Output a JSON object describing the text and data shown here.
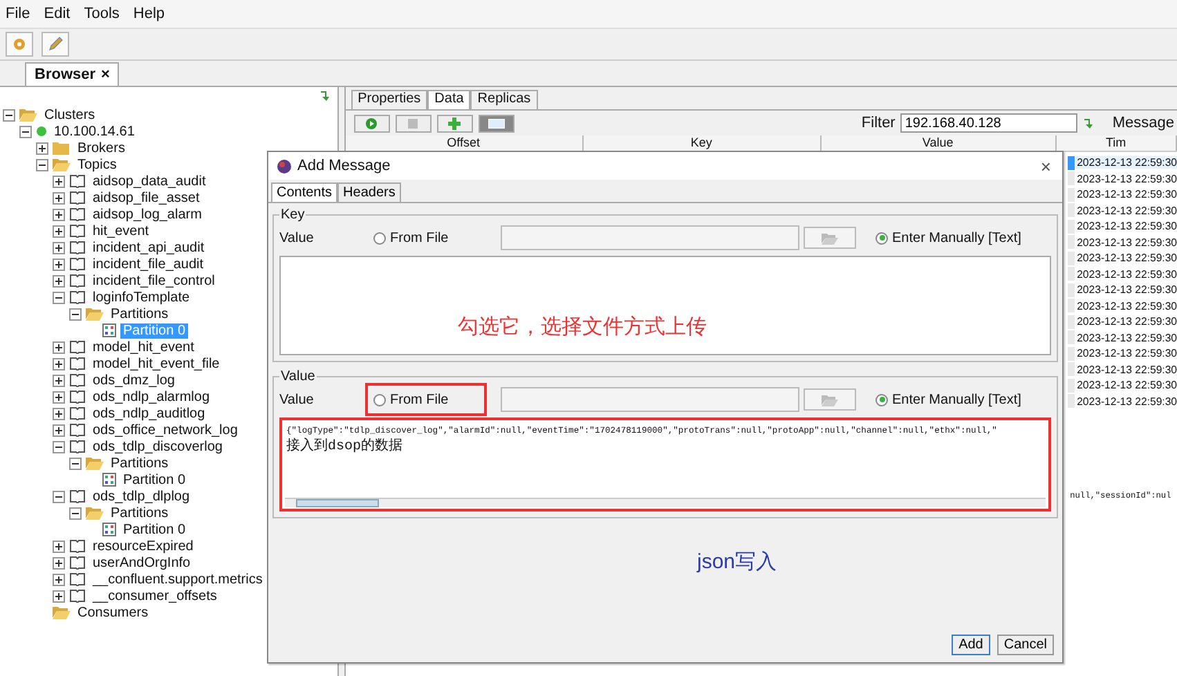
{
  "menu": [
    "File",
    "Edit",
    "Tools",
    "Help"
  ],
  "browser_tab": {
    "label": "Browser",
    "close": "×"
  },
  "tree": [
    {
      "label": "Clusters",
      "kind": "folder",
      "expanded": true,
      "children": [
        {
          "label": "10.100.14.61",
          "kind": "cluster",
          "expanded": true,
          "children": [
            {
              "label": "Brokers",
              "kind": "closed-folder",
              "expanded": false
            },
            {
              "label": "Topics",
              "kind": "folder",
              "expanded": true,
              "children": [
                {
                  "label": "aidsop_data_audit",
                  "kind": "topic",
                  "expanded": false
                },
                {
                  "label": "aidsop_file_asset",
                  "kind": "topic",
                  "expanded": false
                },
                {
                  "label": "aidsop_log_alarm",
                  "kind": "topic",
                  "expanded": false
                },
                {
                  "label": "hit_event",
                  "kind": "topic",
                  "expanded": false
                },
                {
                  "label": "incident_api_audit",
                  "kind": "topic",
                  "expanded": false
                },
                {
                  "label": "incident_file_audit",
                  "kind": "topic",
                  "expanded": false
                },
                {
                  "label": "incident_file_control",
                  "kind": "topic",
                  "expanded": false
                },
                {
                  "label": "loginfoTemplate",
                  "kind": "topic",
                  "expanded": true,
                  "children": [
                    {
                      "label": "Partitions",
                      "kind": "folder",
                      "expanded": true,
                      "children": [
                        {
                          "label": "Partition 0",
                          "kind": "partition",
                          "selected": true
                        }
                      ]
                    }
                  ]
                },
                {
                  "label": "model_hit_event",
                  "kind": "topic",
                  "expanded": false
                },
                {
                  "label": "model_hit_event_file",
                  "kind": "topic",
                  "expanded": false
                },
                {
                  "label": "ods_dmz_log",
                  "kind": "topic",
                  "expanded": false
                },
                {
                  "label": "ods_ndlp_alarmlog",
                  "kind": "topic",
                  "expanded": false
                },
                {
                  "label": "ods_ndlp_auditlog",
                  "kind": "topic",
                  "expanded": false
                },
                {
                  "label": "ods_office_network_log",
                  "kind": "topic",
                  "expanded": false
                },
                {
                  "label": "ods_tdlp_discoverlog",
                  "kind": "topic",
                  "expanded": true,
                  "children": [
                    {
                      "label": "Partitions",
                      "kind": "folder",
                      "expanded": true,
                      "children": [
                        {
                          "label": "Partition 0",
                          "kind": "partition",
                          "selected": false
                        }
                      ]
                    }
                  ]
                },
                {
                  "label": "ods_tdlp_dlplog",
                  "kind": "topic",
                  "expanded": true,
                  "children": [
                    {
                      "label": "Partitions",
                      "kind": "folder",
                      "expanded": true,
                      "children": [
                        {
                          "label": "Partition 0",
                          "kind": "partition",
                          "selected": false
                        }
                      ]
                    }
                  ]
                },
                {
                  "label": "resourceExpired",
                  "kind": "topic",
                  "expanded": false
                },
                {
                  "label": "userAndOrgInfo",
                  "kind": "topic",
                  "expanded": false
                },
                {
                  "label": "__confluent.support.metrics",
                  "kind": "topic",
                  "expanded": false
                },
                {
                  "label": "__consumer_offsets",
                  "kind": "topic",
                  "expanded": false
                }
              ]
            },
            {
              "label": "Consumers",
              "kind": "folder"
            }
          ]
        }
      ]
    }
  ],
  "detail_tabs": [
    {
      "label": "Properties",
      "selected": false
    },
    {
      "label": "Data",
      "selected": true
    },
    {
      "label": "Replicas",
      "selected": false
    }
  ],
  "filter": {
    "label": "Filter",
    "value": "192.168.40.128"
  },
  "message_label": "Message",
  "table": {
    "columns": [
      "Offset",
      "Key",
      "Value",
      "Tim"
    ],
    "rows": [
      {
        "time": "2023-12-13 22:59:30",
        "selected": true
      },
      {
        "time": "2023-12-13 22:59:30",
        "selected": false
      },
      {
        "time": "2023-12-13 22:59:30",
        "selected": false
      },
      {
        "time": "2023-12-13 22:59:30",
        "selected": false
      },
      {
        "time": "2023-12-13 22:59:30",
        "selected": false
      },
      {
        "time": "2023-12-13 22:59:30",
        "selected": false
      },
      {
        "time": "2023-12-13 22:59:30",
        "selected": false
      },
      {
        "time": "2023-12-13 22:59:30",
        "selected": false
      },
      {
        "time": "2023-12-13 22:59:30",
        "selected": false
      },
      {
        "time": "2023-12-13 22:59:30",
        "selected": false
      },
      {
        "time": "2023-12-13 22:59:30",
        "selected": false
      },
      {
        "time": "2023-12-13 22:59:30",
        "selected": false
      },
      {
        "time": "2023-12-13 22:59:30",
        "selected": false
      },
      {
        "time": "2023-12-13 22:59:30",
        "selected": false
      },
      {
        "time": "2023-12-13 22:59:30",
        "selected": false
      },
      {
        "time": "2023-12-13 22:59:30",
        "selected": false
      }
    ]
  },
  "detail_text": "null,\"sessionId\":nul",
  "dialog": {
    "title": "Add Message",
    "close": "×",
    "tabs": [
      {
        "label": "Contents",
        "selected": true
      },
      {
        "label": "Headers",
        "selected": false
      }
    ],
    "sections": [
      {
        "legend": "Key",
        "label": "Value",
        "from_file": {
          "label": "From File",
          "selected": false,
          "highlighted": false
        },
        "manual": {
          "label": "Enter Manually [Text]",
          "selected": true
        },
        "highlighted": false
      },
      {
        "legend": "Value",
        "label": "Value",
        "from_file": {
          "label": "From File",
          "selected": false,
          "highlighted": true
        },
        "manual": {
          "label": "Enter Manually [Text]",
          "selected": true
        },
        "highlighted": true,
        "lines": [
          {
            "text": "{\"logType\":\"tdlp_discover_log\",\"alarmId\":null,\"eventTime\":\"1702478119000\",\"protoTrans\":null,\"protoApp\":null,\"channel\":null,\"ethx\":null,\"",
            "kind": "code"
          },
          {
            "text": "接入到dsop的数据",
            "kind": "cjk"
          }
        ]
      }
    ],
    "buttons": [
      "Add",
      "Cancel"
    ]
  },
  "annotations": [
    {
      "text": "勾选它，选择文件方式上传",
      "color": "#f03030"
    },
    {
      "text": "json写入",
      "color": "#2a3aa8"
    }
  ]
}
